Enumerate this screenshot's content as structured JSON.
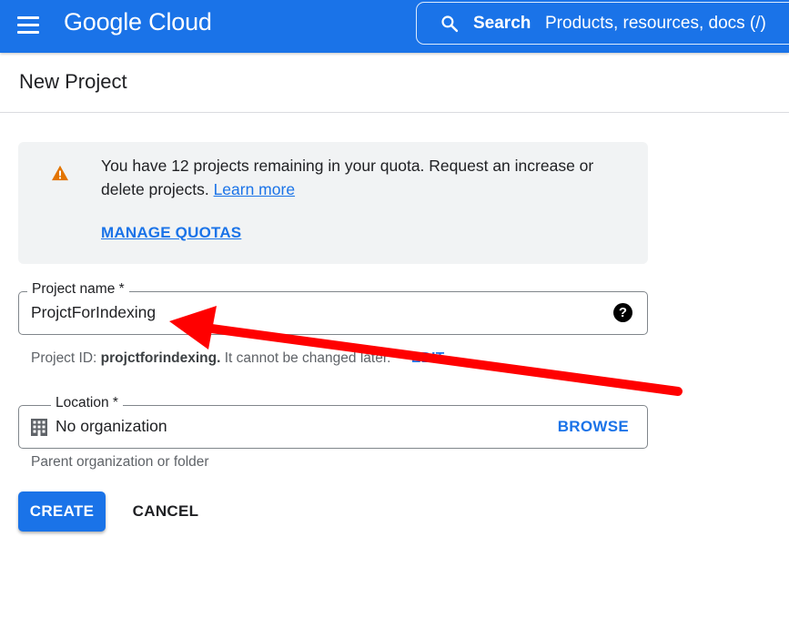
{
  "header": {
    "brand": "Google Cloud",
    "search_label": "Search",
    "search_placeholder": "Products, resources, docs (/)"
  },
  "page": {
    "title": "New Project"
  },
  "notice": {
    "text": "You have 12 projects remaining in your quota. Request an increase or delete projects.",
    "link": "Learn more",
    "action": "MANAGE QUOTAS"
  },
  "project_name": {
    "label": "Project name *",
    "value": "ProjctForIndexing",
    "help_glyph": "?",
    "id_prefix": "Project ID:",
    "id_value": "projctforindexing.",
    "id_suffix": "It cannot be changed later.",
    "edit_label": "EDIT"
  },
  "location": {
    "label": "Location *",
    "value": "No organization",
    "browse_label": "BROWSE",
    "helper": "Parent organization or folder"
  },
  "actions": {
    "create": "CREATE",
    "cancel": "CANCEL"
  },
  "colors": {
    "primary": "#1a73e8",
    "warning": "#e37400",
    "annotation_arrow": "#ff0000"
  },
  "icons": [
    "menu-icon",
    "search-icon",
    "warning-icon",
    "help-icon",
    "building-icon"
  ]
}
